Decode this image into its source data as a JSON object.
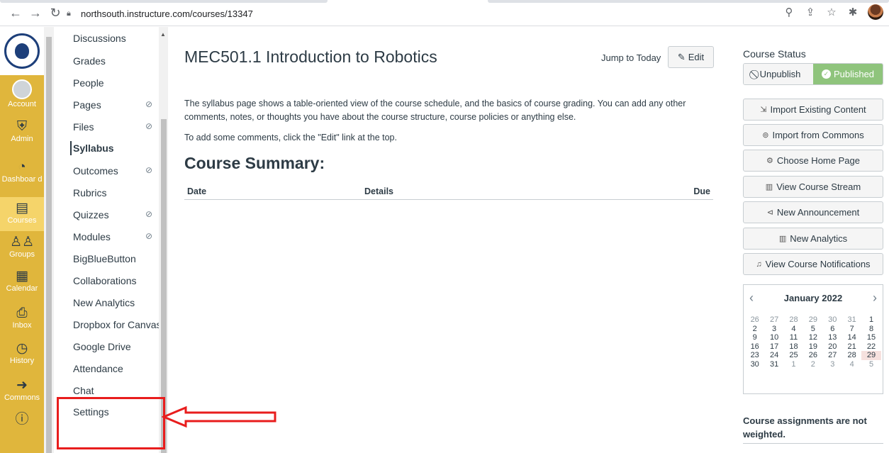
{
  "browser": {
    "url": "northsouth.instructure.com/courses/13347"
  },
  "global_nav": {
    "items": [
      {
        "label": "Account",
        "icon": "account-avatar"
      },
      {
        "label": "Admin",
        "icon": "shield-icon"
      },
      {
        "label": "Dashboar d",
        "icon": "dashboard-icon"
      },
      {
        "label": "Courses",
        "icon": "courses-icon"
      },
      {
        "label": "Groups",
        "icon": "groups-icon"
      },
      {
        "label": "Calendar",
        "icon": "calendar-icon"
      },
      {
        "label": "Inbox",
        "icon": "inbox-icon"
      },
      {
        "label": "History",
        "icon": "history-icon"
      },
      {
        "label": "Commons",
        "icon": "commons-icon"
      },
      {
        "label": "",
        "icon": "help-icon"
      }
    ]
  },
  "course_nav": {
    "items": [
      {
        "label": "Discussions",
        "hidden": false
      },
      {
        "label": "Grades",
        "hidden": false
      },
      {
        "label": "People",
        "hidden": false
      },
      {
        "label": "Pages",
        "hidden": true
      },
      {
        "label": "Files",
        "hidden": true
      },
      {
        "label": "Syllabus",
        "hidden": false,
        "active": true
      },
      {
        "label": "Outcomes",
        "hidden": true
      },
      {
        "label": "Rubrics",
        "hidden": false
      },
      {
        "label": "Quizzes",
        "hidden": true
      },
      {
        "label": "Modules",
        "hidden": true
      },
      {
        "label": "BigBlueButton",
        "hidden": false
      },
      {
        "label": "Collaborations",
        "hidden": false
      },
      {
        "label": "New Analytics",
        "hidden": false
      },
      {
        "label": "Dropbox for Canvas",
        "hidden": false
      },
      {
        "label": "Google Drive",
        "hidden": false
      },
      {
        "label": "Attendance",
        "hidden": false
      },
      {
        "label": "Chat",
        "hidden": false
      },
      {
        "label": "Settings",
        "hidden": false
      }
    ]
  },
  "main": {
    "title": "MEC501.1 Introduction to Robotics",
    "jump_to_today": "Jump to Today",
    "edit_label": "Edit",
    "description": "The syllabus page shows a table-oriented view of the course schedule, and the basics of course grading. You can add any other comments, notes, or thoughts you have about the course structure, course policies or anything else.",
    "description2": "To add some comments, click the \"Edit\" link at the top.",
    "summary_heading": "Course Summary:",
    "table_headers": {
      "date": "Date",
      "details": "Details",
      "due": "Due"
    }
  },
  "sidebar": {
    "course_status": "Course Status",
    "unpublish": "Unpublish",
    "published": "Published",
    "buttons": [
      {
        "label": "Import Existing Content",
        "icon": "import-icon"
      },
      {
        "label": "Import from Commons",
        "icon": "commons-icon"
      },
      {
        "label": "Choose Home Page",
        "icon": "home-icon"
      },
      {
        "label": "View Course Stream",
        "icon": "stream-icon"
      },
      {
        "label": "New Announcement",
        "icon": "announcement-icon"
      },
      {
        "label": "New Analytics",
        "icon": "analytics-icon"
      },
      {
        "label": "View Course Notifications",
        "icon": "bell-icon"
      }
    ],
    "calendar": {
      "month": "January 2022",
      "weeks": [
        [
          "26",
          "27",
          "28",
          "29",
          "30",
          "31",
          "1"
        ],
        [
          "2",
          "3",
          "4",
          "5",
          "6",
          "7",
          "8"
        ],
        [
          "9",
          "10",
          "11",
          "12",
          "13",
          "14",
          "15"
        ],
        [
          "16",
          "17",
          "18",
          "19",
          "20",
          "21",
          "22"
        ],
        [
          "23",
          "24",
          "25",
          "26",
          "27",
          "28",
          "29"
        ],
        [
          "30",
          "31",
          "1",
          "2",
          "3",
          "4",
          "5"
        ]
      ],
      "today": "29"
    },
    "weighted_note": "Course assignments are not weighted."
  },
  "colors": {
    "global_nav_bg": "#e0b63c",
    "published_green": "#8fc47c",
    "annotation_red": "#e81d1d"
  }
}
